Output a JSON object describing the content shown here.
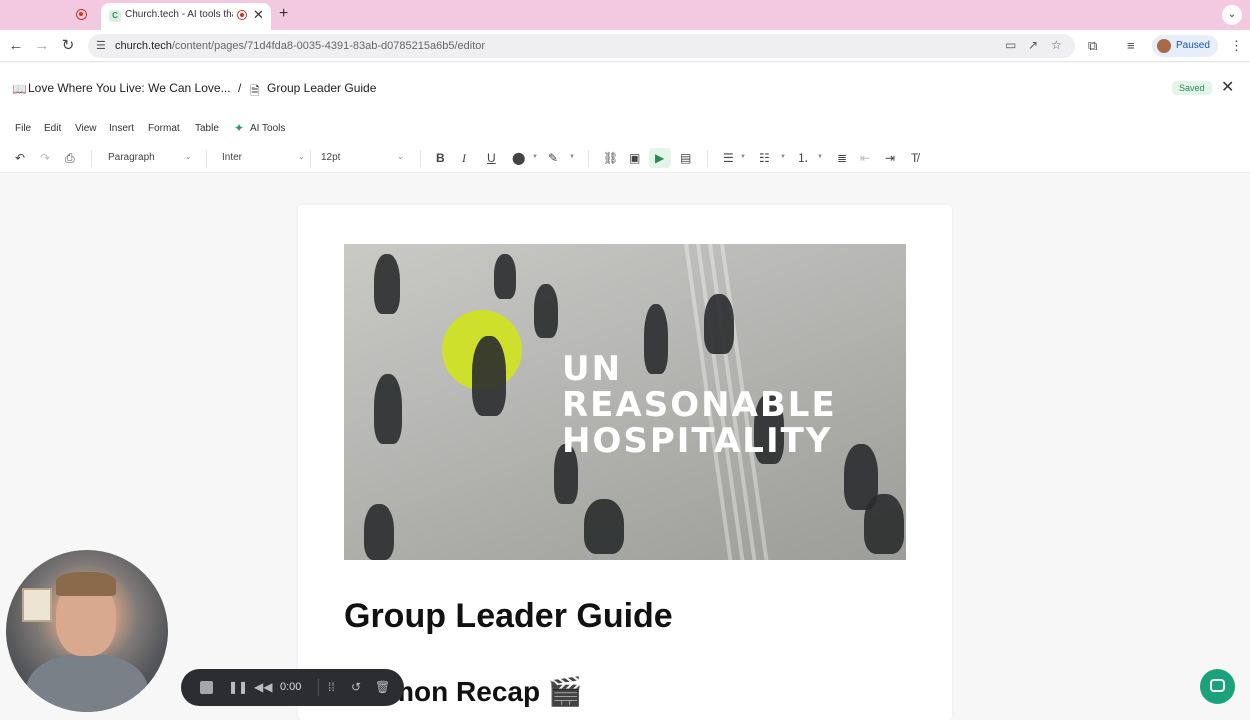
{
  "browser": {
    "tab_title": "Church.tech - AI tools tha",
    "tab_favicon": "C",
    "url_host": "church.tech",
    "url_path": "/content/pages/71d4fda8-0035-4391-83ab-d0785215a6b5/editor",
    "profile_label": "Paused"
  },
  "header": {
    "breadcrumb_parent": "Love Where You Live: We Can Love...",
    "breadcrumb_separator": "/",
    "breadcrumb_current": "Group Leader Guide",
    "saved_badge": "Saved"
  },
  "menubar": {
    "items": [
      "File",
      "Edit",
      "View",
      "Insert",
      "Format",
      "Table",
      "AI Tools"
    ]
  },
  "toolbar": {
    "block_style": "Paragraph",
    "font_family": "Inter",
    "font_size": "12pt"
  },
  "document": {
    "hero_lines": [
      "UN",
      "REASONABLE",
      "HOSPITALITY"
    ],
    "hero_accent_color": "#cfe02c",
    "title": "Group Leader Guide",
    "section_heading": "Sermon Recap 🎬"
  },
  "recorder": {
    "time": "0:00"
  },
  "colors": {
    "tabstrip_bg": "#f3c9e2",
    "saved_badge_bg": "#e3f4ea",
    "chat_button": "#1aa37a"
  }
}
